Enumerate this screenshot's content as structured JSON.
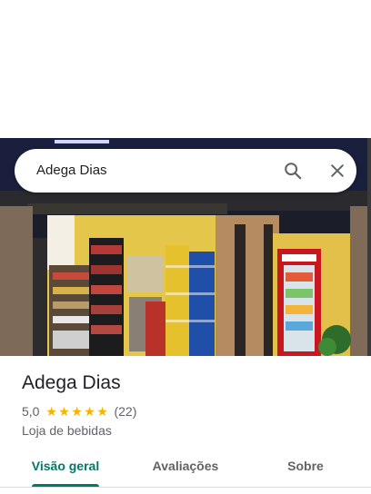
{
  "search": {
    "query": "Adega Dias"
  },
  "hero": {
    "description_icon": "storefront-photo"
  },
  "place": {
    "name": "Adega Dias",
    "rating": "5,0",
    "stars": 5,
    "reviews": "(22)",
    "category": "Loja de bebidas"
  },
  "tabs": [
    {
      "label": "Visão geral",
      "active": true
    },
    {
      "label": "Avaliações",
      "active": false
    },
    {
      "label": "Sobre",
      "active": false
    }
  ],
  "colors": {
    "accent": "#00796b",
    "star": "#f6b400",
    "text_primary": "#202124",
    "text_secondary": "#5f6368"
  },
  "icons": {
    "search": "search-icon",
    "close": "close-icon",
    "star": "star-icon"
  }
}
